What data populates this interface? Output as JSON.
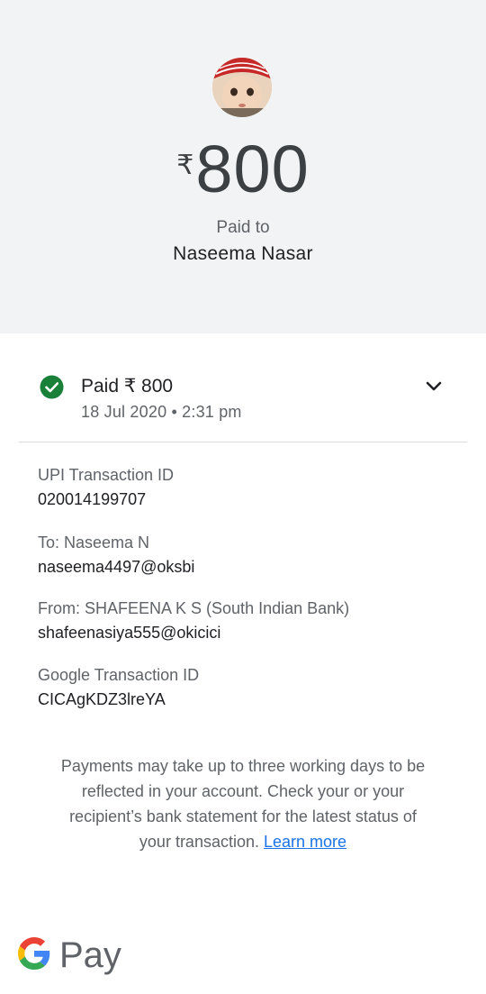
{
  "header": {
    "currency_symbol": "₹",
    "amount": "800",
    "paid_to_label": "Paid to",
    "payee_name": "Naseema Nasar"
  },
  "status": {
    "title": "Paid ₹ 800",
    "date": "18 Jul 2020 • 2:31 pm",
    "icon": "check-circle-icon",
    "color": "#188038"
  },
  "details": [
    {
      "label": "UPI Transaction ID",
      "value": "020014199707"
    },
    {
      "label": "To: Naseema  N",
      "value": "naseema4497@oksbi"
    },
    {
      "label": "From: SHAFEENA K S (South Indian Bank)",
      "value": "shafeenasiya555@okicici"
    },
    {
      "label": "Google Transaction ID",
      "value": "CICAgKDZ3lreYA"
    }
  ],
  "notice": {
    "text": "Payments may take up to three working days to be reflected in your account. Check your or your recipient’s bank statement for the latest status of your transaction.",
    "link": "Learn more"
  },
  "footer": {
    "brand": "Pay",
    "logo_icon": "google-g-icon"
  },
  "colors": {
    "header_bg": "#f1f3f4",
    "link": "#1a73e8",
    "success": "#188038"
  }
}
